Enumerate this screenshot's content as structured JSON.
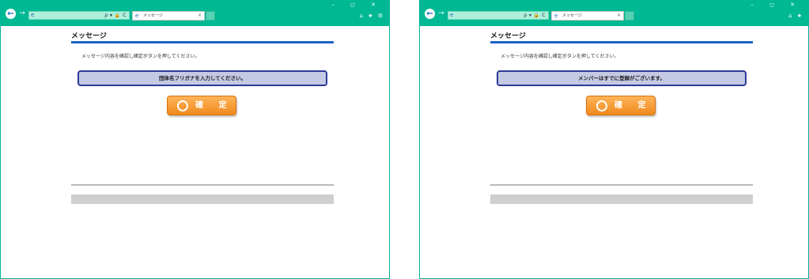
{
  "windows": [
    {
      "tab_label": "メッセージ",
      "page_title": "メッセージ",
      "instruction": "メッセージ内容を確認し確定ボタンを押してください。",
      "message": "団体名フリガナを入力してください。",
      "confirm_label": "確 定"
    },
    {
      "tab_label": "メッセージ",
      "page_title": "メッセージ",
      "instruction": "メッセージ内容を確認し確定ボタンを押してください。",
      "message": "メンバーはすでに登録がございます。",
      "confirm_label": "確 定"
    }
  ],
  "icons": {
    "back": "←",
    "forward": "→",
    "ie": "e",
    "address_tools": "ρ ▾ 🔒 C",
    "tab_close": "×",
    "window_controls": "– ◻ ✕",
    "window_tools_left": "⌂ ★ ⚙",
    "window_tools_right": "⌂ ★"
  },
  "colors": {
    "chrome": "#00b894",
    "title_rule": "#1e64c8",
    "message_box_fill": "#c4c9e4",
    "message_box_border": "#2b3a96",
    "button_orange": "#f08a1c"
  }
}
